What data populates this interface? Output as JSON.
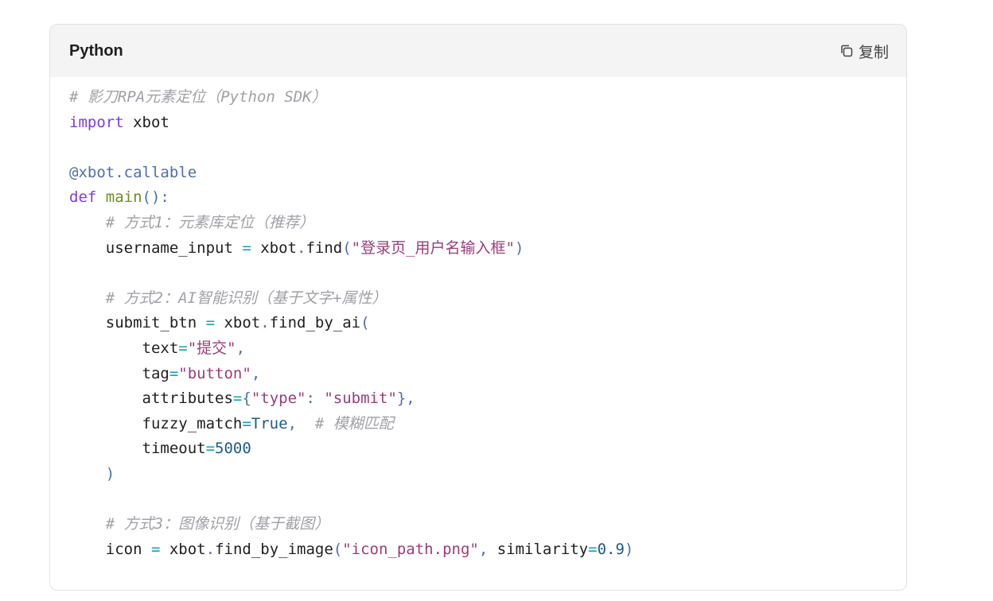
{
  "header": {
    "language": "Python",
    "copy_label": "复制",
    "copy_icon": "copy-icon"
  },
  "code_lines": [
    [
      {
        "t": "comment",
        "v": "# 影刀RPA元素定位（Python SDK）"
      }
    ],
    [
      {
        "t": "keyword",
        "v": "import"
      },
      {
        "t": "plain",
        "v": " xbot"
      }
    ],
    [],
    [
      {
        "t": "decorator",
        "v": "@xbot.callable"
      }
    ],
    [
      {
        "t": "keyword",
        "v": "def"
      },
      {
        "t": "plain",
        "v": " "
      },
      {
        "t": "func",
        "v": "main"
      },
      {
        "t": "punct",
        "v": "():"
      }
    ],
    [
      {
        "t": "plain",
        "v": "    "
      },
      {
        "t": "comment",
        "v": "# 方式1：元素库定位（推荐）"
      }
    ],
    [
      {
        "t": "plain",
        "v": "    username_input "
      },
      {
        "t": "op",
        "v": "="
      },
      {
        "t": "plain",
        "v": " xbot"
      },
      {
        "t": "punct",
        "v": "."
      },
      {
        "t": "plain",
        "v": "find"
      },
      {
        "t": "punct",
        "v": "("
      },
      {
        "t": "string",
        "v": "\"登录页_用户名输入框\""
      },
      {
        "t": "punct",
        "v": ")"
      }
    ],
    [],
    [
      {
        "t": "plain",
        "v": "    "
      },
      {
        "t": "comment",
        "v": "# 方式2：AI智能识别（基于文字+属性）"
      }
    ],
    [
      {
        "t": "plain",
        "v": "    submit_btn "
      },
      {
        "t": "op",
        "v": "="
      },
      {
        "t": "plain",
        "v": " xbot"
      },
      {
        "t": "punct",
        "v": "."
      },
      {
        "t": "plain",
        "v": "find_by_ai"
      },
      {
        "t": "punct",
        "v": "("
      }
    ],
    [
      {
        "t": "plain",
        "v": "        text"
      },
      {
        "t": "op",
        "v": "="
      },
      {
        "t": "string",
        "v": "\"提交\""
      },
      {
        "t": "punct",
        "v": ","
      }
    ],
    [
      {
        "t": "plain",
        "v": "        tag"
      },
      {
        "t": "op",
        "v": "="
      },
      {
        "t": "string",
        "v": "\"button\""
      },
      {
        "t": "punct",
        "v": ","
      }
    ],
    [
      {
        "t": "plain",
        "v": "        attributes"
      },
      {
        "t": "op",
        "v": "="
      },
      {
        "t": "punct",
        "v": "{"
      },
      {
        "t": "string",
        "v": "\"type\""
      },
      {
        "t": "punct",
        "v": ": "
      },
      {
        "t": "string",
        "v": "\"submit\""
      },
      {
        "t": "punct",
        "v": "},"
      }
    ],
    [
      {
        "t": "plain",
        "v": "        fuzzy_match"
      },
      {
        "t": "op",
        "v": "="
      },
      {
        "t": "bool",
        "v": "True"
      },
      {
        "t": "punct",
        "v": ","
      },
      {
        "t": "plain",
        "v": "  "
      },
      {
        "t": "comment",
        "v": "# 模糊匹配"
      }
    ],
    [
      {
        "t": "plain",
        "v": "        timeout"
      },
      {
        "t": "op",
        "v": "="
      },
      {
        "t": "number",
        "v": "5000"
      }
    ],
    [
      {
        "t": "plain",
        "v": "    "
      },
      {
        "t": "punct",
        "v": ")"
      }
    ],
    [],
    [
      {
        "t": "plain",
        "v": "    "
      },
      {
        "t": "comment",
        "v": "# 方式3：图像识别（基于截图）"
      }
    ],
    [
      {
        "t": "plain",
        "v": "    icon "
      },
      {
        "t": "op",
        "v": "="
      },
      {
        "t": "plain",
        "v": " xbot"
      },
      {
        "t": "punct",
        "v": "."
      },
      {
        "t": "plain",
        "v": "find_by_image"
      },
      {
        "t": "punct",
        "v": "("
      },
      {
        "t": "string",
        "v": "\"icon_path.png\""
      },
      {
        "t": "punct",
        "v": ","
      },
      {
        "t": "plain",
        "v": " similarity"
      },
      {
        "t": "op",
        "v": "="
      },
      {
        "t": "number",
        "v": "0.9"
      },
      {
        "t": "punct",
        "v": ")"
      }
    ]
  ]
}
